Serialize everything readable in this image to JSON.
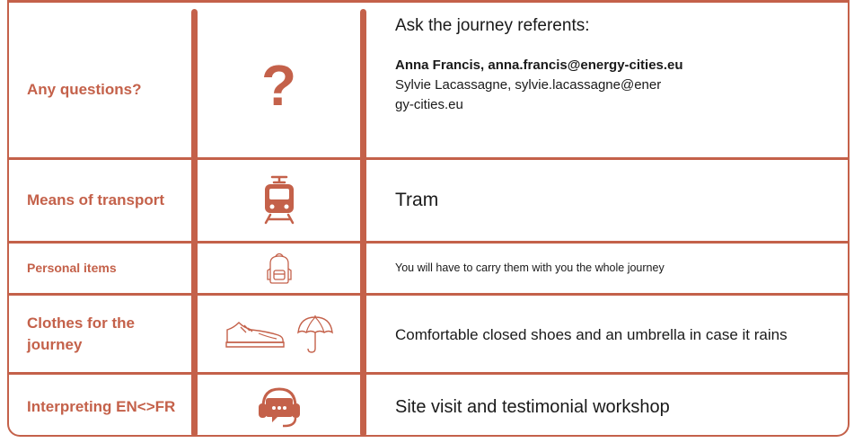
{
  "rows": [
    {
      "label": "Any questions?",
      "icon": "question-mark-icon",
      "icon_glyph": "?",
      "text_heading": "Ask the journey referents:",
      "contact_primary": "Anna Francis, anna.francis@energy-cities.eu",
      "contact_secondary": "Sylvie Lacassagne, sylvie.lacassagne@energy-cities.eu"
    },
    {
      "label": "Means of transport",
      "icon": "tram-icon",
      "text": "Tram"
    },
    {
      "label": "Personal items",
      "icon": "backpack-icon",
      "text": "You will have to carry them with you the whole journey"
    },
    {
      "label": "Clothes for the journey",
      "icons": [
        "sneaker-icon",
        "umbrella-icon"
      ],
      "text": "Comfortable closed shoes and an umbrella in case it rains"
    },
    {
      "label": "Interpreting EN<>FR",
      "icon": "headset-chat-icon",
      "text": "Site visit and testimonial workshop"
    }
  ],
  "colors": {
    "accent": "#c4614a",
    "text": "#1a1a1a",
    "background": "#ffffff"
  }
}
